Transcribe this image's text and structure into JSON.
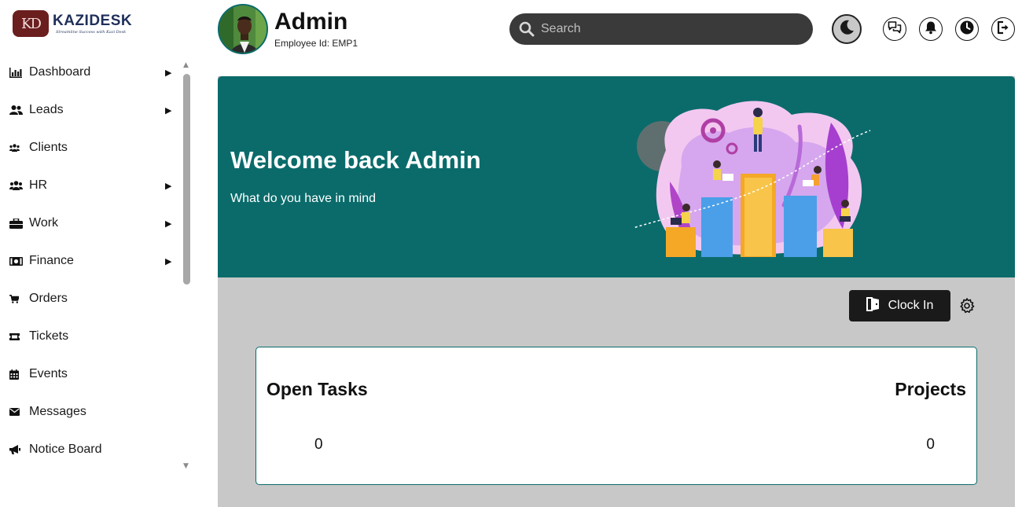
{
  "brand": {
    "name": "KAZIDESK",
    "tagline": "Streamline Success with Kazi Desk",
    "mark": "KD"
  },
  "sidebar": {
    "items": [
      {
        "label": "Dashboard",
        "icon": "bar-chart-icon",
        "has_submenu": true
      },
      {
        "label": "Leads",
        "icon": "users-icon",
        "has_submenu": true
      },
      {
        "label": "Clients",
        "icon": "group-icon",
        "has_submenu": false
      },
      {
        "label": "HR",
        "icon": "people-icon",
        "has_submenu": true
      },
      {
        "label": "Work",
        "icon": "briefcase-icon",
        "has_submenu": true
      },
      {
        "label": "Finance",
        "icon": "money-icon",
        "has_submenu": true
      },
      {
        "label": "Orders",
        "icon": "cart-icon",
        "has_submenu": false
      },
      {
        "label": "Tickets",
        "icon": "ticket-icon",
        "has_submenu": false
      },
      {
        "label": "Events",
        "icon": "calendar-icon",
        "has_submenu": false
      },
      {
        "label": "Messages",
        "icon": "envelope-icon",
        "has_submenu": false
      },
      {
        "label": "Notice Board",
        "icon": "megaphone-icon",
        "has_submenu": false
      }
    ]
  },
  "header": {
    "user_name": "Admin",
    "employee_id": "Employee Id: EMP1",
    "search_placeholder": "Search",
    "icons": [
      "moon-icon",
      "chat-icon",
      "bell-icon",
      "clock-icon",
      "logout-icon"
    ]
  },
  "banner": {
    "title": "Welcome back Admin",
    "subtitle": "What do you have in mind"
  },
  "actions": {
    "clock_in_label": "Clock In"
  },
  "stats": {
    "open_tasks_label": "Open Tasks",
    "open_tasks_value": "0",
    "projects_label": "Projects",
    "projects_value": "0"
  },
  "colors": {
    "teal": "#0b6b6b",
    "main_bg": "#c8c8c8",
    "dark": "#1a1a1a",
    "brand_maroon": "#6b1e1e",
    "brand_navy": "#1f2f5a"
  }
}
